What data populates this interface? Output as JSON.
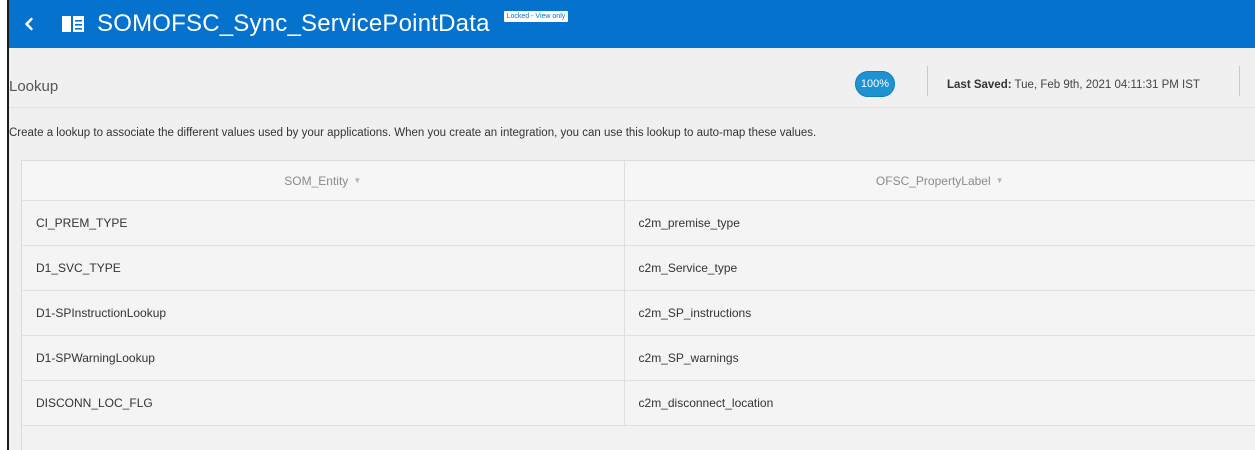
{
  "header": {
    "title": "SOMOFSC_Sync_ServicePointData",
    "lock_badge": "Locked - View only"
  },
  "toolbar": {
    "breadcrumb": "Lookup",
    "zoom": "100%",
    "last_saved_label": "Last Saved:",
    "last_saved_value": " Tue, Feb 9th, 2021 04:11:31 PM IST"
  },
  "description": "Create a lookup to associate the different values used by your applications. When you create an integration, you can use this lookup to auto-map these values.",
  "table": {
    "columns": [
      "SOM_Entity",
      "OFSC_PropertyLabel"
    ],
    "rows": [
      [
        "CI_PREM_TYPE",
        "c2m_premise_type"
      ],
      [
        "D1_SVC_TYPE",
        "c2m_Service_type"
      ],
      [
        "D1-SPInstructionLookup",
        "c2m_SP_instructions"
      ],
      [
        "D1-SPWarningLookup",
        "c2m_SP_warnings"
      ],
      [
        "DISCONN_LOC_FLG",
        "c2m_disconnect_location"
      ]
    ]
  },
  "colors": {
    "header_bg": "#0572ce",
    "zoom_badge": "#1d93d2"
  },
  "icons": [
    "chevron-left-icon",
    "document-icon",
    "sort-caret-icon"
  ]
}
